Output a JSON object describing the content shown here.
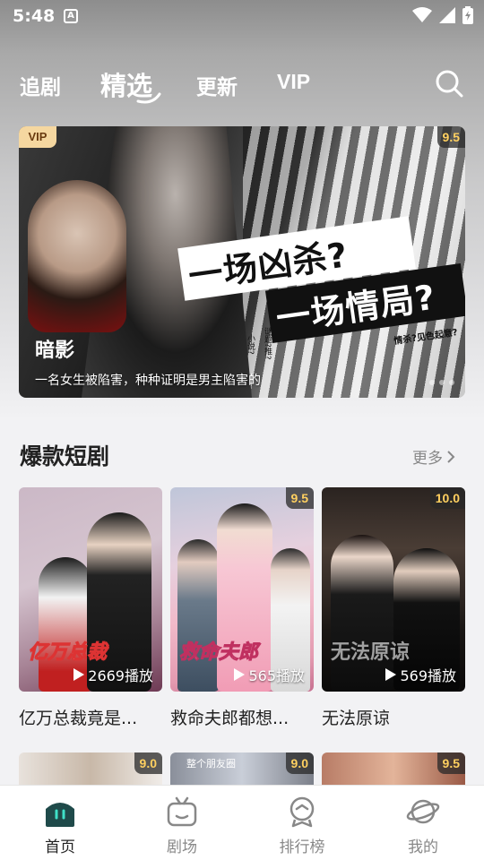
{
  "status_bar": {
    "time": "5:48",
    "notification_letter": "A"
  },
  "top_tabs": {
    "follow": "追剧",
    "featured": "精选",
    "update": "更新",
    "vip": "VIP",
    "active": "featured"
  },
  "banner": {
    "badge": "VIP",
    "score": "9.5",
    "title": "暗影",
    "description": "一名女生被陷害，种种证明是男主陷害的",
    "slogan_line1": "一场凶杀?",
    "slogan_line2": "一场情局?",
    "caption": "情杀?见色起意?",
    "side_text1": "小说?",
    "side_text2": "谜题?推?"
  },
  "section": {
    "title": "爆款短剧",
    "more_label": "更多"
  },
  "cards": [
    {
      "name": "亿万总裁竟是...",
      "plays": "2669播放",
      "score": "",
      "poster_text": "亿万总裁"
    },
    {
      "name": "救命夫郎都想...",
      "plays": "565播放",
      "score": "9.5",
      "poster_text": "救命夫郎"
    },
    {
      "name": "无法原谅",
      "plays": "569播放",
      "score": "10.0",
      "poster_text": "无法原谅"
    }
  ],
  "next_row_scores": [
    "9.0",
    "9.0",
    "9.5"
  ],
  "next_row_text": "整个朋友圈",
  "bottom_nav": {
    "home": "首页",
    "theater": "剧场",
    "rank": "排行榜",
    "mine": "我的",
    "active": "home"
  },
  "colors": {
    "accent_dark_teal": "#1f4a4a",
    "vip_gold": "#f5d7a0",
    "score_yellow": "#ffd060",
    "inactive_gray": "#888888"
  },
  "icons": [
    "search-icon",
    "play-icon",
    "chevron-right-icon",
    "home-icon",
    "tv-icon",
    "rank-icon",
    "planet-icon",
    "wifi-icon",
    "signal-icon",
    "battery-icon"
  ]
}
